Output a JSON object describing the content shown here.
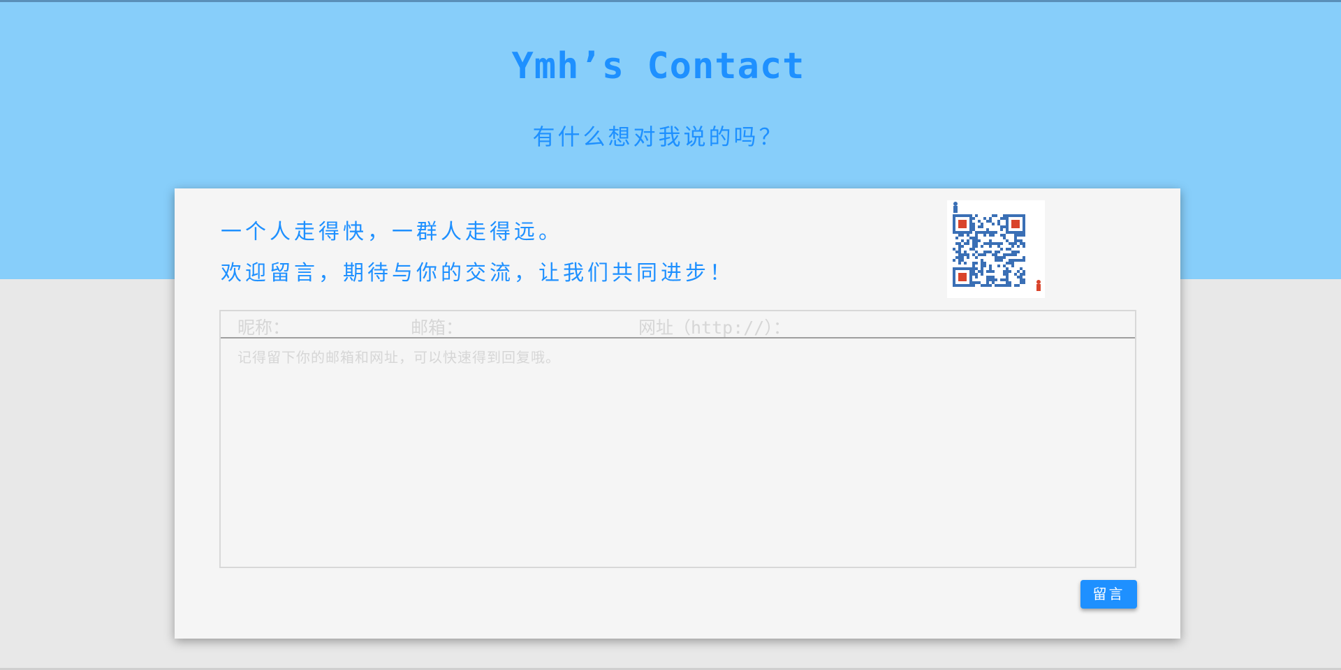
{
  "header": {
    "title": "Ymh’s Contact",
    "subtitle": "有什么想对我说的吗？"
  },
  "intro": {
    "line1": "一个人走得快，一群人走得远。",
    "line2": "欢迎留言，期待与你的交流，让我们共同进步！"
  },
  "qr_code": {
    "icon": "wechat-qr-code"
  },
  "form": {
    "nickname_label": "昵称：",
    "email_label": "邮箱：",
    "url_label": "网址（http://）：",
    "message_placeholder": "记得留下你的邮箱和网址，可以快速得到回复哦。",
    "submit_label": "留言"
  },
  "colors": {
    "accent": "#1e90ff",
    "hero_bg": "#87cefa",
    "page_bg": "#e8e8e8",
    "card_bg": "#f5f5f5",
    "placeholder": "#d6d6d6"
  }
}
